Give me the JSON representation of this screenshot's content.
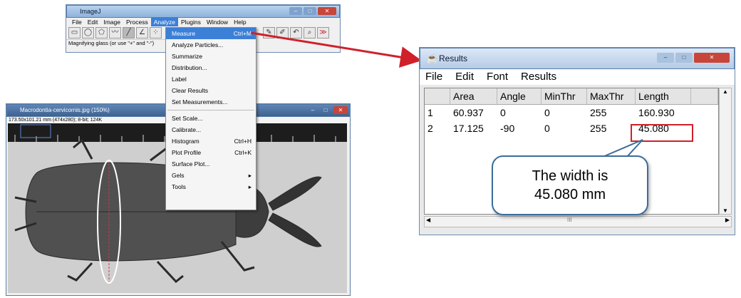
{
  "imagej": {
    "title": "ImageJ",
    "menu": [
      "File",
      "Edit",
      "Image",
      "Process",
      "Analyze",
      "Plugins",
      "Window",
      "Help"
    ],
    "status": "Magnifying glass (or use \"+\" and \"-\")",
    "tools": [
      {
        "icon": "rectangle-tool-icon",
        "glyph": "▭"
      },
      {
        "icon": "oval-tool-icon",
        "glyph": "◯"
      },
      {
        "icon": "polygon-tool-icon",
        "glyph": "⬠"
      },
      {
        "icon": "freehand-tool-icon",
        "glyph": "〰"
      },
      {
        "icon": "line-tool-icon",
        "glyph": "╱"
      },
      {
        "icon": "angle-tool-icon",
        "glyph": "∠"
      },
      {
        "icon": "point-tool-icon",
        "glyph": "⁘"
      },
      {
        "icon": "wand-tool-icon",
        "glyph": "✎"
      },
      {
        "icon": "text-tool-icon",
        "glyph": "A"
      },
      {
        "icon": "dropper-tool-icon",
        "glyph": "✐"
      },
      {
        "icon": "pan-tool-icon",
        "glyph": "↶"
      },
      {
        "icon": "zoom-tool-icon",
        "glyph": "🔍"
      },
      {
        "icon": "more-tools-icon",
        "glyph": "≫"
      }
    ]
  },
  "analyze_menu": {
    "items": [
      {
        "label": "Measure",
        "shortcut": "Ctrl+M"
      },
      {
        "label": "Analyze Particles...",
        "shortcut": ""
      },
      {
        "label": "Summarize",
        "shortcut": ""
      },
      {
        "label": "Distribution...",
        "shortcut": ""
      },
      {
        "label": "Label",
        "shortcut": ""
      },
      {
        "label": "Clear Results",
        "shortcut": ""
      },
      {
        "label": "Set Measurements...",
        "shortcut": ""
      },
      {
        "label": "Set Scale...",
        "shortcut": ""
      },
      {
        "label": "Calibrate...",
        "shortcut": ""
      },
      {
        "label": "Histogram",
        "shortcut": "Ctrl+H"
      },
      {
        "label": "Plot Profile",
        "shortcut": "Ctrl+K"
      },
      {
        "label": "Surface Plot...",
        "shortcut": ""
      },
      {
        "label": "Gels",
        "shortcut": "▸"
      },
      {
        "label": "Tools",
        "shortcut": "▸"
      }
    ]
  },
  "image_window": {
    "title": "Macrodontia-cervicornis.jpg (150%)",
    "subtitle": "173.50x101.21 mm (474x280); 8-bit; 124K"
  },
  "results": {
    "title": "Results",
    "menu": [
      "File",
      "Edit",
      "Font",
      "Results"
    ],
    "columns": [
      "",
      "Area",
      "Angle",
      "MinThr",
      "MaxThr",
      "Length",
      ""
    ],
    "rows": [
      [
        "1",
        "60.937",
        "0",
        "0",
        "255",
        "160.930",
        ""
      ],
      [
        "2",
        "17.125",
        "-90",
        "0",
        "255",
        "45.080",
        ""
      ]
    ],
    "hscroll_label": "III"
  },
  "callout": {
    "line1": "The width is",
    "line2": "45.080 mm"
  },
  "colors": {
    "highlight": "#d0202a",
    "menu_selected": "#3c7fd6",
    "callout_border": "#3d6e9a"
  }
}
